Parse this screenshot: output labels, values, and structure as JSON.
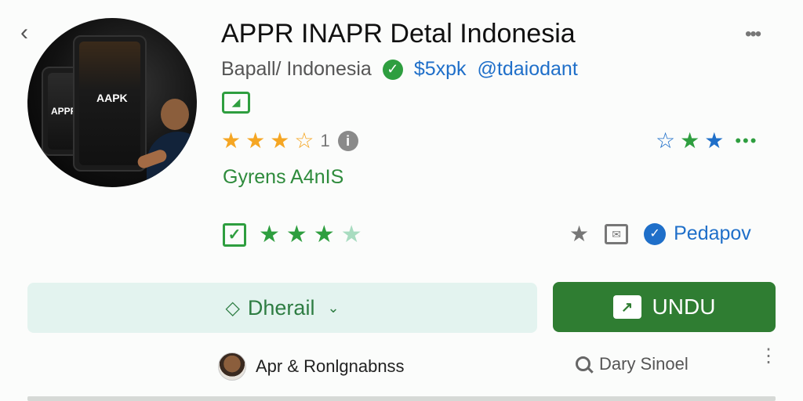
{
  "app": {
    "title": "APPR INAPR Detal Indonesia",
    "publisher": "Bapall/ Indonesia",
    "price": "$5xpk",
    "handle": "@tdaiodant",
    "category": "Gyrens A4nIS",
    "hero_logo": "AAPK",
    "hero_logo_alt": "APPR"
  },
  "icons": {
    "back": "chevron-left-icon",
    "more": "more-dots-icon",
    "verified": "check-icon",
    "tag": "tag-icon",
    "info": "info-icon",
    "checkbox": "checkbox-icon",
    "star": "star-icon",
    "mail": "mail-icon",
    "badge": "verified-badge-icon",
    "search": "search-icon",
    "install": "install-icon"
  },
  "rating": {
    "stars": 3,
    "count": "1",
    "secondary_stars": 3
  },
  "developer_label": "Pedapov",
  "buttons": {
    "detail": "Dherail",
    "install": "UNDU"
  },
  "footer": {
    "author": "Apr & Ronlgnabnss",
    "search_label": "Dary Sinoel"
  },
  "colors": {
    "accent_green": "#2f7d32",
    "link_blue": "#1f6fc9",
    "star_gold": "#f5a623",
    "detail_bg": "#e3f3ef"
  }
}
